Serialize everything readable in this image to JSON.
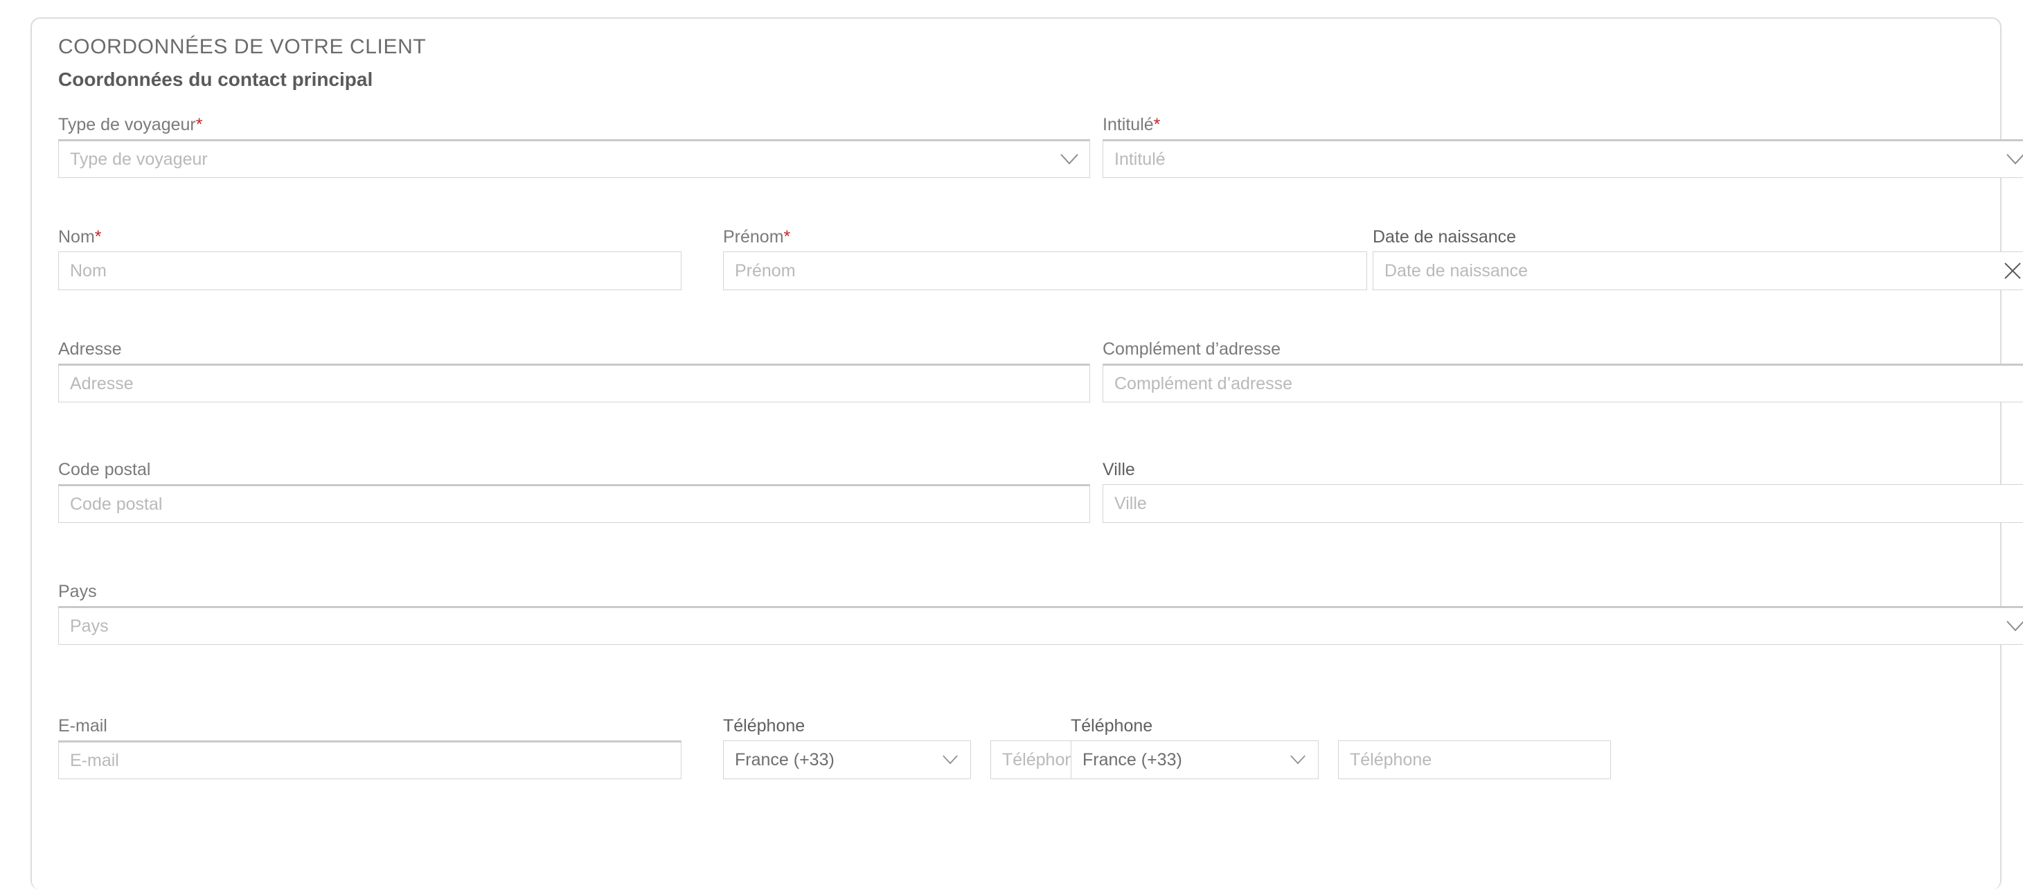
{
  "card": {
    "section_title": "COORDONNÉES DE VOTRE CLIENT",
    "sub_title": "Coordonnées du contact principal"
  },
  "required_marker": "*",
  "icons": {
    "chevron_down": "chevron-down-icon",
    "clear": "close-x-icon"
  },
  "fields": {
    "traveller_type": {
      "label": "Type de voyageur",
      "placeholder": "Type de voyageur",
      "required": true
    },
    "title": {
      "label": "Intitulé",
      "placeholder": "Intitulé",
      "required": true
    },
    "last_name": {
      "label": "Nom",
      "placeholder": "Nom",
      "required": true
    },
    "first_name": {
      "label": "Prénom",
      "placeholder": "Prénom",
      "required": true
    },
    "birth_date": {
      "label": "Date de naissance",
      "placeholder": "Date de naissance",
      "required": false
    },
    "address": {
      "label": "Adresse",
      "placeholder": "Adresse",
      "required": false
    },
    "address_extra": {
      "label": "Complément d’adresse",
      "placeholder": "Complément d’adresse",
      "required": false
    },
    "postal_code": {
      "label": "Code postal",
      "placeholder": "Code postal",
      "required": false
    },
    "city": {
      "label": "Ville",
      "placeholder": "Ville",
      "required": false
    },
    "country": {
      "label": "Pays",
      "placeholder": "Pays",
      "required": false
    },
    "email": {
      "label": "E-mail",
      "placeholder": "E-mail",
      "required": false
    },
    "phone_1": {
      "label": "Téléphone",
      "country_code_value": "France (+33)",
      "placeholder": "Téléphone",
      "required": false
    },
    "phone_2": {
      "label": "Téléphone",
      "country_code_value": "France (+33)",
      "placeholder": "Téléphone",
      "required": false
    }
  },
  "colors": {
    "required_red": "#c0272d",
    "label_grey": "#7a7a7a",
    "placeholder_grey": "#b9b9b9",
    "value_grey": "#6e6e6e",
    "border_grey": "#d4d4d4",
    "card_border": "#dcdcdc"
  }
}
